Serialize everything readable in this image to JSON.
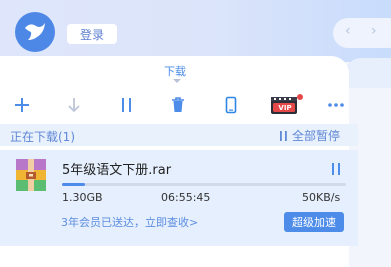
{
  "header": {
    "login_label": "登录"
  },
  "tabs": {
    "active_label": "下载"
  },
  "toolbar": {
    "vip_badge": "VIP"
  },
  "downloading": {
    "header_label": "正在下载(1)",
    "pause_all_label": "全部暂停",
    "tasks": [
      {
        "filename": "5年级语文下册.rar",
        "size": "1.30GB",
        "time_remaining": "06:55:45",
        "speed": "50KB/s",
        "progress": 0.08,
        "promo_text": "3年会员已送达，立即查收>",
        "speed_up_label": "超级加速"
      }
    ]
  },
  "colors": {
    "accent": "#4d8ce8",
    "vip_red": "#e54848"
  }
}
